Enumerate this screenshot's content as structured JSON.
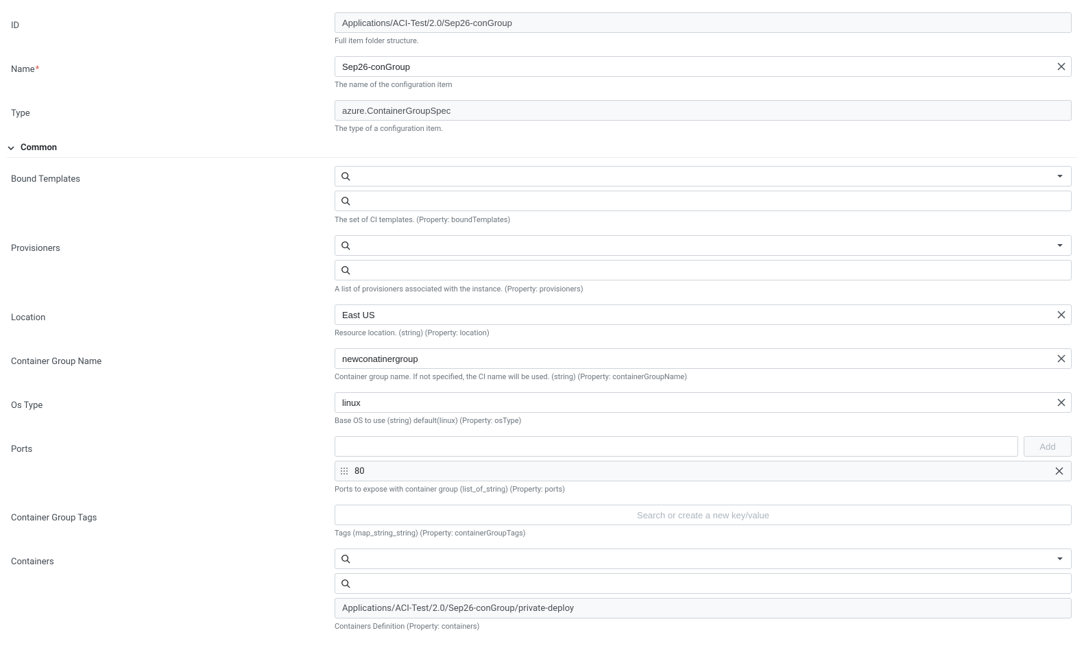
{
  "fields": {
    "id": {
      "label": "ID",
      "value": "Applications/ACI-Test/2.0/Sep26-conGroup",
      "help": "Full item folder structure."
    },
    "name": {
      "label": "Name",
      "required": true,
      "value": "Sep26-conGroup",
      "help": "The name of the configuration item"
    },
    "type": {
      "label": "Type",
      "value": "azure.ContainerGroupSpec",
      "help": "The type of a configuration item."
    }
  },
  "section": {
    "title": "Common"
  },
  "common": {
    "boundTemplates": {
      "label": "Bound Templates",
      "help": "The set of CI templates. (Property: boundTemplates)"
    },
    "provisioners": {
      "label": "Provisioners",
      "help": "A list of provisioners associated with the instance. (Property: provisioners)"
    },
    "location": {
      "label": "Location",
      "value": "East US",
      "help": "Resource location. (string) (Property: location)"
    },
    "containerGroupName": {
      "label": "Container Group Name",
      "value": "newconatinergroup",
      "help": "Container group name. If not specified, the CI name will be used. (string) (Property: containerGroupName)"
    },
    "osType": {
      "label": "Os Type",
      "value": "linux",
      "help": "Base OS to use (string) default(linux) (Property: osType)"
    },
    "ports": {
      "label": "Ports",
      "addLabel": "Add",
      "items": [
        "80"
      ],
      "help": "Ports to expose with container group (list_of_string) (Property: ports)"
    },
    "containerGroupTags": {
      "label": "Container Group Tags",
      "placeholder": "Search or create a new key/value",
      "help": "Tags (map_string_string) (Property: containerGroupTags)"
    },
    "containers": {
      "label": "Containers",
      "items": [
        "Applications/ACI-Test/2.0/Sep26-conGroup/private-deploy"
      ],
      "help": "Containers Definition (Property: containers)"
    }
  }
}
